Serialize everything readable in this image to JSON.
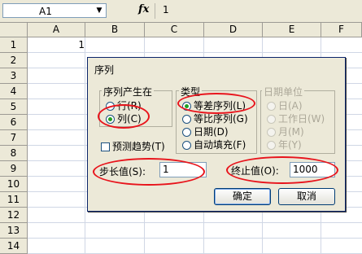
{
  "formula_bar": {
    "name_box": "A1",
    "fx_label": "fx",
    "formula_value": "1"
  },
  "sheet": {
    "columns": [
      "A",
      "B",
      "C",
      "D",
      "E",
      "F"
    ],
    "rows": [
      "1",
      "2",
      "3",
      "4",
      "5",
      "6",
      "7",
      "8",
      "9",
      "10",
      "11",
      "12",
      "13",
      "14"
    ],
    "cell_a1": "1"
  },
  "dialog": {
    "title": "序列",
    "series_in": {
      "label": "序列产生在",
      "options": [
        "行(R)",
        "列(C)"
      ],
      "selected": "列(C)"
    },
    "type": {
      "label": "类型",
      "options": [
        "等差序列(L)",
        "等比序列(G)",
        "日期(D)",
        "自动填充(F)"
      ],
      "selected": "等差序列(L)"
    },
    "date_unit": {
      "label": "日期单位",
      "options": [
        "日(A)",
        "工作日(W)",
        "月(M)",
        "年(Y)"
      ],
      "selected": "日(A)",
      "disabled": true
    },
    "trend_checkbox": "预测趋势(T)",
    "step_label": "步长值(S):",
    "step_value": "1",
    "stop_label": "终止值(O):",
    "stop_value": "1000",
    "ok_label": "确定",
    "cancel_label": "取消"
  },
  "colors": {
    "chrome": "#ece9d8",
    "annotation": "#e8141c",
    "radio_selected": "#21a121"
  }
}
